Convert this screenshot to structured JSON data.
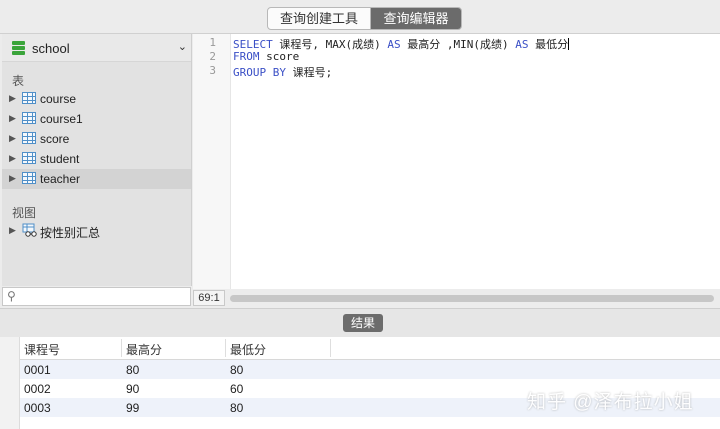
{
  "toolbar": {
    "tabs": [
      {
        "label": "查询创建工具"
      },
      {
        "label": "查询编辑器"
      }
    ]
  },
  "sidebar": {
    "database": "school",
    "tables_heading": "表",
    "tables": [
      {
        "label": "course"
      },
      {
        "label": "course1"
      },
      {
        "label": "score"
      },
      {
        "label": "student"
      },
      {
        "label": "teacher"
      }
    ],
    "views_heading": "视图",
    "views": [
      {
        "label": "按性别汇总"
      }
    ],
    "search_placeholder": ""
  },
  "editor": {
    "line_numbers": [
      "1",
      "2",
      "3"
    ],
    "lines": [
      {
        "kw1": "SELECT",
        "t1": " 课程号, MAX(成绩) ",
        "kw2": "AS",
        "t2": " 最高分 ,MIN(成绩) ",
        "kw3": "AS",
        "t3": " 最低分"
      },
      {
        "kw1": "FROM",
        "t1": " score"
      },
      {
        "kw1": "GROUP BY",
        "t1": " 课程号;"
      }
    ],
    "cursor_position": "69:1"
  },
  "results": {
    "label": "结果",
    "columns": [
      "课程号",
      "最高分",
      "最低分"
    ],
    "rows": [
      [
        "0001",
        "80",
        "80"
      ],
      [
        "0002",
        "90",
        "60"
      ],
      [
        "0003",
        "99",
        "80"
      ]
    ]
  },
  "watermark": "知乎 @泽布拉小姐",
  "colors": {
    "keyword": "#3a4fc6",
    "active_tab": "#6b6b6b",
    "db_icon": "#3aa43a",
    "alt_row": "#eef2fa"
  }
}
